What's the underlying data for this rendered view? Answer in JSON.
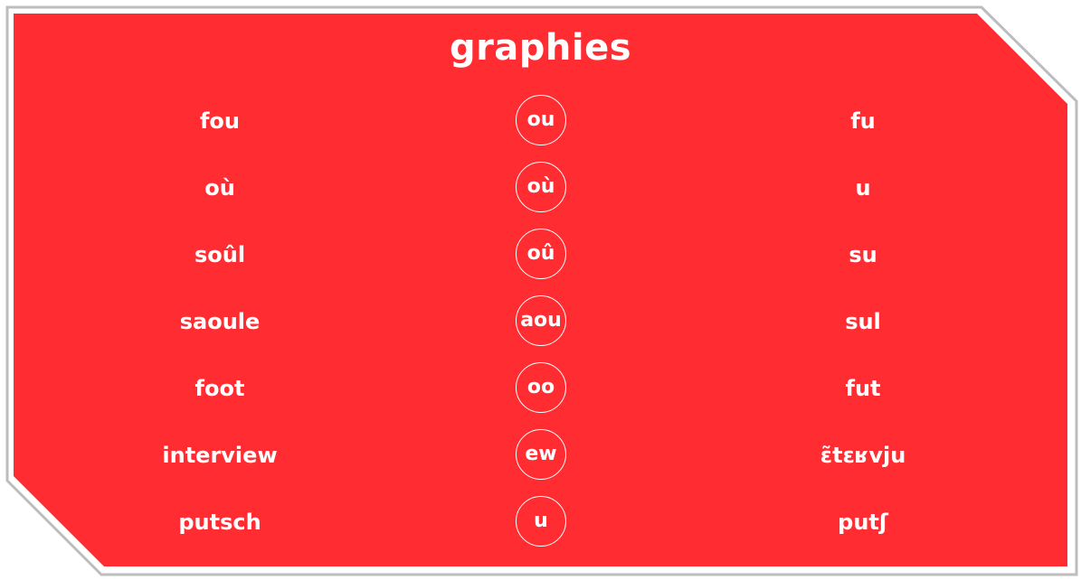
{
  "colors": {
    "card_background": "#ff2d32",
    "text": "#ffffff",
    "frame_border": "#c8c8c8"
  },
  "title": "graphies",
  "rows": [
    {
      "word": "fou",
      "grapheme": "ou",
      "phonetic": "fu"
    },
    {
      "word": "où",
      "grapheme": "où",
      "phonetic": "u"
    },
    {
      "word": "soûl",
      "grapheme": "oû",
      "phonetic": "su"
    },
    {
      "word": "saoule",
      "grapheme": "aou",
      "phonetic": "sul"
    },
    {
      "word": "foot",
      "grapheme": "oo",
      "phonetic": "fut"
    },
    {
      "word": "interview",
      "grapheme": "ew",
      "phonetic": "ɛ̃tɛʁvju"
    },
    {
      "word": "putsch",
      "grapheme": "u",
      "phonetic": "putʃ"
    }
  ]
}
